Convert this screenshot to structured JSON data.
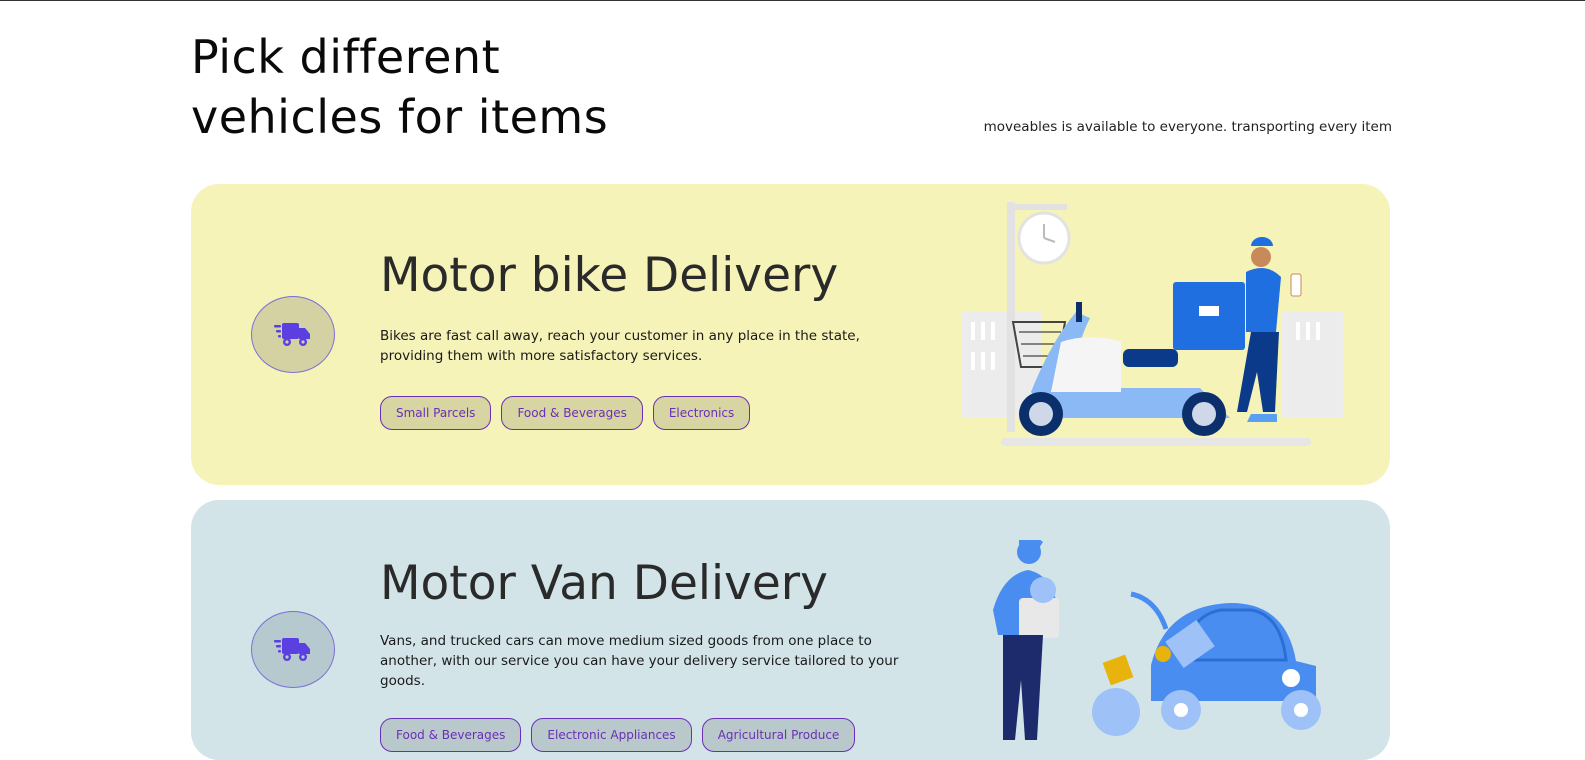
{
  "header": {
    "title_line1": "Pick different",
    "title_line2": "vehicles for items",
    "tagline": "moveables is available to everyone. transporting every item"
  },
  "cards": [
    {
      "icon": "truck-fast-icon",
      "title": "Motor bike Delivery",
      "description": "Bikes are fast call away, reach your customer in any place in the state, providing them with more satisfactory services.",
      "tags": [
        "Small Parcels",
        "Food & Beverages",
        "Electronics"
      ],
      "background": "#f5f3b8"
    },
    {
      "icon": "truck-fast-icon",
      "title": "Motor Van Delivery",
      "description": "Vans, and trucked cars can move medium sized goods from one place to another, with our service you can have your delivery service tailored to your goods.",
      "tags": [
        "Food & Beverages",
        "Electronic Appliances",
        "Agricultural Produce"
      ],
      "background": "#d2e4e8"
    }
  ],
  "colors": {
    "accent": "#6b2fb6",
    "icon": "#5b3fe0"
  }
}
